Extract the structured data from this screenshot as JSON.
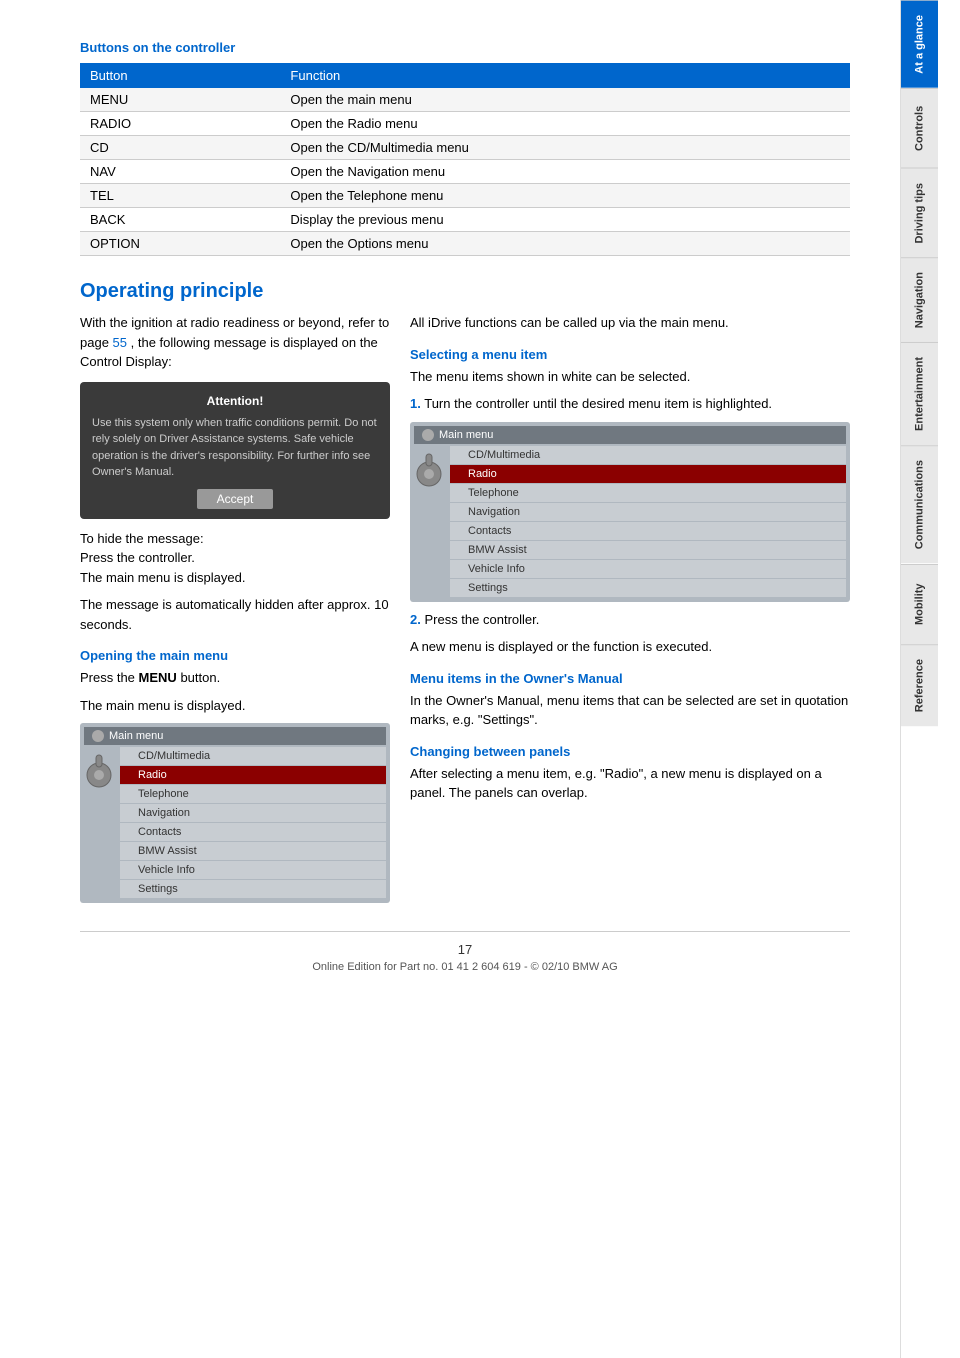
{
  "page": {
    "number": "17",
    "footer_text": "Online Edition for Part no. 01 41 2 604 619 - © 02/10 BMW AG"
  },
  "sidebar": {
    "tabs": [
      {
        "label": "At a glance",
        "active": true
      },
      {
        "label": "Controls",
        "active": false
      },
      {
        "label": "Driving tips",
        "active": false
      },
      {
        "label": "Navigation",
        "active": false
      },
      {
        "label": "Entertainment",
        "active": false
      },
      {
        "label": "Communications",
        "active": false
      },
      {
        "label": "Mobility",
        "active": false
      },
      {
        "label": "Reference",
        "active": false
      }
    ]
  },
  "buttons_section": {
    "heading": "Buttons on the controller",
    "table": {
      "col1_header": "Button",
      "col2_header": "Function",
      "rows": [
        {
          "button": "MENU",
          "function": "Open the main menu"
        },
        {
          "button": "RADIO",
          "function": "Open the Radio menu"
        },
        {
          "button": "CD",
          "function": "Open the CD/Multimedia menu"
        },
        {
          "button": "NAV",
          "function": "Open the Navigation menu"
        },
        {
          "button": "TEL",
          "function": "Open the Telephone menu"
        },
        {
          "button": "BACK",
          "function": "Display the previous menu"
        },
        {
          "button": "OPTION",
          "function": "Open the Options menu"
        }
      ]
    }
  },
  "operating_principle": {
    "heading": "Operating principle",
    "intro_text": "With the ignition at radio readiness or beyond, refer to page",
    "intro_link": "55",
    "intro_text2": ", the following message is displayed on the Control Display:",
    "attention_box": {
      "header": "Attention!",
      "text": "Use this system only when traffic conditions permit. Do not rely solely on Driver Assistance systems. Safe vehicle operation is the driver's responsibility. For further info see Owner's Manual.",
      "accept_btn": "Accept"
    },
    "hide_message_text": "To hide the message:\nPress the controller.\nThe main menu is displayed.",
    "auto_hide_text": "The message is automatically hidden after approx. 10 seconds.",
    "opening_main_menu": {
      "heading": "Opening the main menu",
      "text1": "Press the",
      "bold_word": "MENU",
      "text2": "button.",
      "text3": "The main menu is displayed."
    },
    "menu_items_left": [
      "CD/Multimedia",
      "Radio",
      "Telephone",
      "Navigation",
      "Contacts",
      "BMW Assist",
      "Vehicle Info",
      "Settings"
    ],
    "menu_highlighted_left": "Radio",
    "all_idrive_text": "All iDrive functions can be called up via the main menu.",
    "selecting_menu_item": {
      "heading": "Selecting a menu item",
      "text": "The menu items shown in white can be selected.",
      "step1": "Turn the controller until the desired menu item is highlighted.",
      "menu_items": [
        "CD/Multimedia",
        "Radio",
        "Telephone",
        "Navigation",
        "Contacts",
        "BMW Assist",
        "Vehicle Info",
        "Settings"
      ],
      "menu_highlighted": "Radio",
      "step2": "Press the controller.",
      "step2_text": "A new menu is displayed or the function is executed."
    },
    "owners_manual": {
      "heading": "Menu items in the Owner's Manual",
      "text": "In the Owner's Manual, menu items that can be selected are set in quotation marks, e.g. \"Settings\"."
    },
    "changing_panels": {
      "heading": "Changing between panels",
      "text": "After selecting a menu item, e.g. \"Radio\", a new menu is displayed on a panel. The panels can overlap."
    }
  }
}
